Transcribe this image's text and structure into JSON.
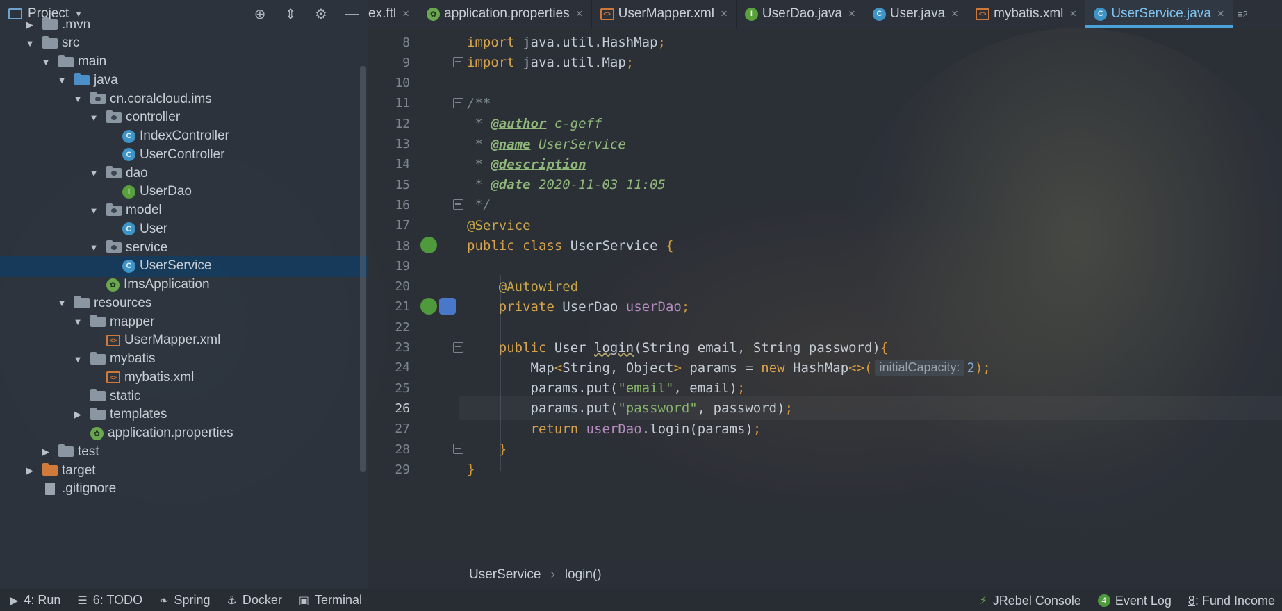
{
  "project_header": {
    "title": "Project",
    "icons": [
      "locate-icon",
      "collapse-icon",
      "gear-icon",
      "hide-icon"
    ]
  },
  "tree": [
    {
      "label": ".mvn",
      "indent": 1,
      "toggle": "▶",
      "icon": "folder"
    },
    {
      "label": "src",
      "indent": 1,
      "toggle": "▼",
      "icon": "folder"
    },
    {
      "label": "main",
      "indent": 2,
      "toggle": "▼",
      "icon": "folder"
    },
    {
      "label": "java",
      "indent": 3,
      "toggle": "▼",
      "icon": "folder-blue"
    },
    {
      "label": "cn.coralcloud.ims",
      "indent": 4,
      "toggle": "▼",
      "icon": "package"
    },
    {
      "label": "controller",
      "indent": 5,
      "toggle": "▼",
      "icon": "package"
    },
    {
      "label": "IndexController",
      "indent": 6,
      "toggle": "",
      "icon": "class"
    },
    {
      "label": "UserController",
      "indent": 6,
      "toggle": "",
      "icon": "class"
    },
    {
      "label": "dao",
      "indent": 5,
      "toggle": "▼",
      "icon": "package"
    },
    {
      "label": "UserDao",
      "indent": 6,
      "toggle": "",
      "icon": "interface"
    },
    {
      "label": "model",
      "indent": 5,
      "toggle": "▼",
      "icon": "package"
    },
    {
      "label": "User",
      "indent": 6,
      "toggle": "",
      "icon": "class"
    },
    {
      "label": "service",
      "indent": 5,
      "toggle": "▼",
      "icon": "package"
    },
    {
      "label": "UserService",
      "indent": 6,
      "toggle": "",
      "icon": "class",
      "selected": true
    },
    {
      "label": "ImsApplication",
      "indent": 5,
      "toggle": "",
      "icon": "spring"
    },
    {
      "label": "resources",
      "indent": 3,
      "toggle": "▼",
      "icon": "folder"
    },
    {
      "label": "mapper",
      "indent": 4,
      "toggle": "▼",
      "icon": "folder"
    },
    {
      "label": "UserMapper.xml",
      "indent": 5,
      "toggle": "",
      "icon": "xml"
    },
    {
      "label": "mybatis",
      "indent": 4,
      "toggle": "▼",
      "icon": "folder"
    },
    {
      "label": "mybatis.xml",
      "indent": 5,
      "toggle": "",
      "icon": "xml"
    },
    {
      "label": "static",
      "indent": 4,
      "toggle": "",
      "icon": "folder"
    },
    {
      "label": "templates",
      "indent": 4,
      "toggle": "▶",
      "icon": "folder"
    },
    {
      "label": "application.properties",
      "indent": 4,
      "toggle": "",
      "icon": "spring"
    },
    {
      "label": "test",
      "indent": 2,
      "toggle": "▶",
      "icon": "folder"
    },
    {
      "label": "target",
      "indent": 1,
      "toggle": "▶",
      "icon": "folder-orange"
    },
    {
      "label": ".gitignore",
      "indent": 1,
      "toggle": "",
      "icon": "file"
    }
  ],
  "tabs": [
    {
      "label": "ex.ftl",
      "icon": "",
      "active": false
    },
    {
      "label": "application.properties",
      "icon": "spring",
      "active": false
    },
    {
      "label": "UserMapper.xml",
      "icon": "xml",
      "active": false
    },
    {
      "label": "UserDao.java",
      "icon": "interface",
      "active": false
    },
    {
      "label": "User.java",
      "icon": "class",
      "active": false
    },
    {
      "label": "mybatis.xml",
      "icon": "xml",
      "active": false
    },
    {
      "label": "UserService.java",
      "icon": "class",
      "active": true
    }
  ],
  "tab_more": "≡2",
  "editor": {
    "current_line": 26,
    "lines": [
      {
        "n": 8,
        "fold": false,
        "tokens": [
          [
            "kw",
            "import"
          ],
          [
            "p",
            " java.util.HashMap"
          ],
          [
            "punc",
            ";"
          ]
        ]
      },
      {
        "n": 9,
        "fold": true,
        "tokens": [
          [
            "kw",
            "import"
          ],
          [
            "p",
            " java.util.Map"
          ],
          [
            "punc",
            ";"
          ]
        ]
      },
      {
        "n": 10,
        "fold": false,
        "tokens": []
      },
      {
        "n": 11,
        "fold": true,
        "tokens": [
          [
            "cm",
            "/**"
          ]
        ]
      },
      {
        "n": 12,
        "fold": false,
        "tokens": [
          [
            "cm",
            " * "
          ],
          [
            "tag",
            "@author"
          ],
          [
            "tv",
            " c-geff"
          ]
        ]
      },
      {
        "n": 13,
        "fold": false,
        "tokens": [
          [
            "cm",
            " * "
          ],
          [
            "tag",
            "@name"
          ],
          [
            "tv",
            " UserService"
          ]
        ]
      },
      {
        "n": 14,
        "fold": false,
        "tokens": [
          [
            "cm",
            " * "
          ],
          [
            "tag",
            "@description"
          ]
        ]
      },
      {
        "n": 15,
        "fold": false,
        "tokens": [
          [
            "cm",
            " * "
          ],
          [
            "tag",
            "@date"
          ],
          [
            "tv",
            " 2020-11-03 11:05"
          ]
        ]
      },
      {
        "n": 16,
        "fold": true,
        "tokens": [
          [
            "cm",
            " */"
          ]
        ]
      },
      {
        "n": 17,
        "fold": false,
        "tokens": [
          [
            "ann",
            "@Service"
          ]
        ]
      },
      {
        "n": 18,
        "fold": false,
        "gutter": "bean-class",
        "tokens": [
          [
            "kw",
            "public class"
          ],
          [
            "p",
            " UserService "
          ],
          [
            "punc",
            "{"
          ]
        ]
      },
      {
        "n": 19,
        "fold": false,
        "tokens": []
      },
      {
        "n": 20,
        "fold": false,
        "tokens": [
          [
            "p",
            "    "
          ],
          [
            "ann",
            "@Autowired"
          ]
        ]
      },
      {
        "n": 21,
        "fold": false,
        "gutter": "bean-tool",
        "tokens": [
          [
            "p",
            "    "
          ],
          [
            "kw",
            "private"
          ],
          [
            "p",
            " UserDao "
          ],
          [
            "fld",
            "userDao"
          ],
          [
            "punc",
            ";"
          ]
        ]
      },
      {
        "n": 22,
        "fold": false,
        "tokens": []
      },
      {
        "n": 23,
        "fold": true,
        "tokens": [
          [
            "p",
            "    "
          ],
          [
            "kw",
            "public"
          ],
          [
            "p",
            " User "
          ],
          [
            "wavy",
            "login"
          ],
          [
            "p",
            "(String email, String password)"
          ],
          [
            "punc",
            "{"
          ]
        ]
      },
      {
        "n": 24,
        "fold": false,
        "tokens": [
          [
            "p",
            "        Map"
          ],
          [
            "punc",
            "<"
          ],
          [
            "p",
            "String, Object"
          ],
          [
            "punc",
            ">"
          ],
          [
            "p",
            " params = "
          ],
          [
            "kw",
            "new"
          ],
          [
            "p",
            " HashMap"
          ],
          [
            "punc",
            "<>("
          ],
          [
            "hint",
            "initialCapacity:"
          ],
          [
            "num",
            "2"
          ],
          [
            "punc",
            ");"
          ]
        ]
      },
      {
        "n": 25,
        "fold": false,
        "tokens": [
          [
            "p",
            "        params.put("
          ],
          [
            "str",
            "\"email\""
          ],
          [
            "p",
            ", email)"
          ],
          [
            "punc",
            ";"
          ]
        ]
      },
      {
        "n": 26,
        "fold": false,
        "tokens": [
          [
            "p",
            "        params.put("
          ],
          [
            "str",
            "\"password\""
          ],
          [
            "p",
            ", password)"
          ],
          [
            "punc",
            ";"
          ]
        ]
      },
      {
        "n": 27,
        "fold": false,
        "tokens": [
          [
            "p",
            "        "
          ],
          [
            "kw",
            "return"
          ],
          [
            "p",
            " "
          ],
          [
            "fld",
            "userDao"
          ],
          [
            "p",
            ".login(params)"
          ],
          [
            "punc",
            ";"
          ]
        ]
      },
      {
        "n": 28,
        "fold": true,
        "tokens": [
          [
            "p",
            "    "
          ],
          [
            "punc",
            "}"
          ]
        ]
      },
      {
        "n": 29,
        "fold": false,
        "tokens": [
          [
            "punc",
            "}"
          ]
        ]
      }
    ]
  },
  "breadcrumb": {
    "class": "UserService",
    "method": "login()",
    "separator": "›"
  },
  "toolbar": {
    "left": [
      {
        "glyph": "▶",
        "key": "4",
        "label": ": Run",
        "name": "run-tool"
      },
      {
        "glyph": "☰",
        "key": "6",
        "label": ": TODO",
        "name": "todo-tool"
      },
      {
        "glyph": "❧",
        "key": "",
        "label": "Spring",
        "name": "spring-tool"
      },
      {
        "glyph": "⚓",
        "key": "",
        "label": "Docker",
        "name": "docker-tool"
      },
      {
        "glyph": "▣",
        "key": "",
        "label": "Terminal",
        "name": "terminal-tool"
      }
    ],
    "right": [
      {
        "glyph": "⚡",
        "label": "JRebel Console",
        "name": "jrebel-console"
      },
      {
        "badge": "4",
        "label": "Event Log",
        "name": "event-log"
      },
      {
        "key": "8",
        "label": ": Fund Income",
        "name": "fund-income"
      }
    ]
  }
}
